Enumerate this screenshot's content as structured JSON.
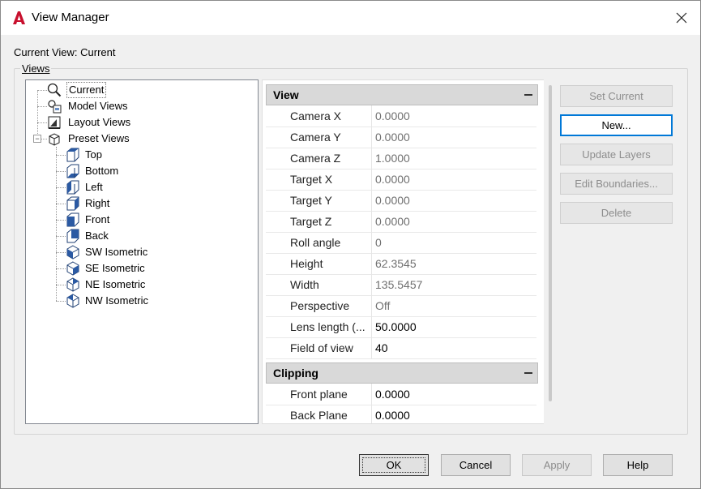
{
  "window": {
    "title": "View Manager"
  },
  "current_view_label": "Current View: Current",
  "views_group_label": "Views",
  "tree": {
    "items": [
      {
        "label": "Current",
        "icon": "magnifier-icon",
        "selected": true
      },
      {
        "label": "Model Views",
        "icon": "model-views-icon"
      },
      {
        "label": "Layout Views",
        "icon": "layout-views-icon"
      },
      {
        "label": "Preset Views",
        "icon": "preset-views-cube-icon",
        "expanded": true
      },
      {
        "label": "Top",
        "icon": "cube-top-icon"
      },
      {
        "label": "Bottom",
        "icon": "cube-bottom-icon"
      },
      {
        "label": "Left",
        "icon": "cube-left-icon"
      },
      {
        "label": "Right",
        "icon": "cube-right-icon"
      },
      {
        "label": "Front",
        "icon": "cube-front-icon"
      },
      {
        "label": "Back",
        "icon": "cube-back-icon"
      },
      {
        "label": "SW Isometric",
        "icon": "iso-sw-icon"
      },
      {
        "label": "SE Isometric",
        "icon": "iso-se-icon"
      },
      {
        "label": "NE Isometric",
        "icon": "iso-ne-icon"
      },
      {
        "label": "NW Isometric",
        "icon": "iso-nw-icon"
      }
    ]
  },
  "properties": {
    "view_section": {
      "title": "View",
      "rows": [
        {
          "name": "Camera X",
          "value": "0.0000"
        },
        {
          "name": "Camera Y",
          "value": "0.0000"
        },
        {
          "name": "Camera Z",
          "value": "1.0000"
        },
        {
          "name": "Target X",
          "value": "0.0000"
        },
        {
          "name": "Target Y",
          "value": "0.0000"
        },
        {
          "name": "Target Z",
          "value": "0.0000"
        },
        {
          "name": "Roll angle",
          "value": "0"
        },
        {
          "name": "Height",
          "value": "62.3545"
        },
        {
          "name": "Width",
          "value": "135.5457"
        },
        {
          "name": "Perspective",
          "value": "Off"
        },
        {
          "name": "Lens length (...",
          "value": "50.0000"
        },
        {
          "name": "Field of view",
          "value": "40"
        }
      ]
    },
    "clipping_section": {
      "title": "Clipping",
      "rows": [
        {
          "name": "Front plane",
          "value": "0.0000"
        },
        {
          "name": "Back Plane",
          "value": "0.0000"
        }
      ]
    }
  },
  "side_buttons": {
    "set_current": "Set Current",
    "new": "New...",
    "update_layers": "Update Layers",
    "edit_boundaries": "Edit Boundaries...",
    "delete": "Delete"
  },
  "footer_buttons": {
    "ok": "OK",
    "cancel": "Cancel",
    "apply": "Apply",
    "help": "Help"
  },
  "colors": {
    "accent": "#0078d7",
    "app_icon": "#c8102e"
  }
}
